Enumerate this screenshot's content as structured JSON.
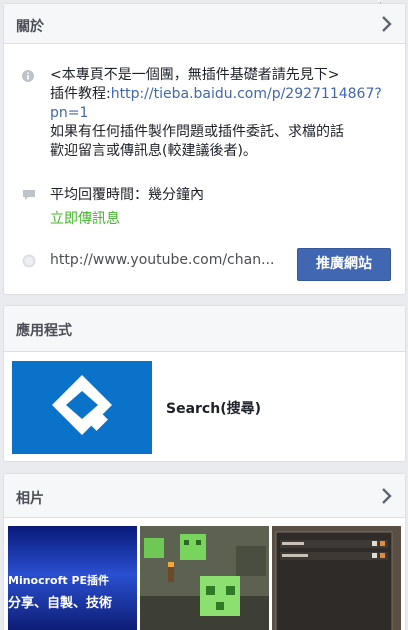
{
  "about": {
    "title": "關於",
    "description_line1": "<本專頁不是一個團，無插件基礎者請先見下>",
    "tutorial_prefix": "插件教程:",
    "tutorial_url_line1": "http://tieba.baidu.com/p/2927114867?",
    "tutorial_url_line2": "pn=1",
    "description_line3": "如果有任何插件製作問題或插件委託、求檔的話",
    "description_line4": "歡迎留言或傳訊息(較建議後者)。",
    "response_time": "平均回覆時間：幾分鐘內",
    "send_message": "立即傳訊息",
    "website": "http://www.youtube.com/chan...",
    "promote_button": "推廣網站"
  },
  "apps": {
    "title": "應用程式",
    "app_name": "Search(搜尋)"
  },
  "photos": {
    "title": "相片",
    "photo1_text_line1": "Minocroft  PE插件",
    "photo1_text_line2": "分享、自製、技術"
  },
  "colors": {
    "link": "#4267b2",
    "green": "#42b72a",
    "button": "#4267b2",
    "app_bg": "#0b72c9"
  }
}
